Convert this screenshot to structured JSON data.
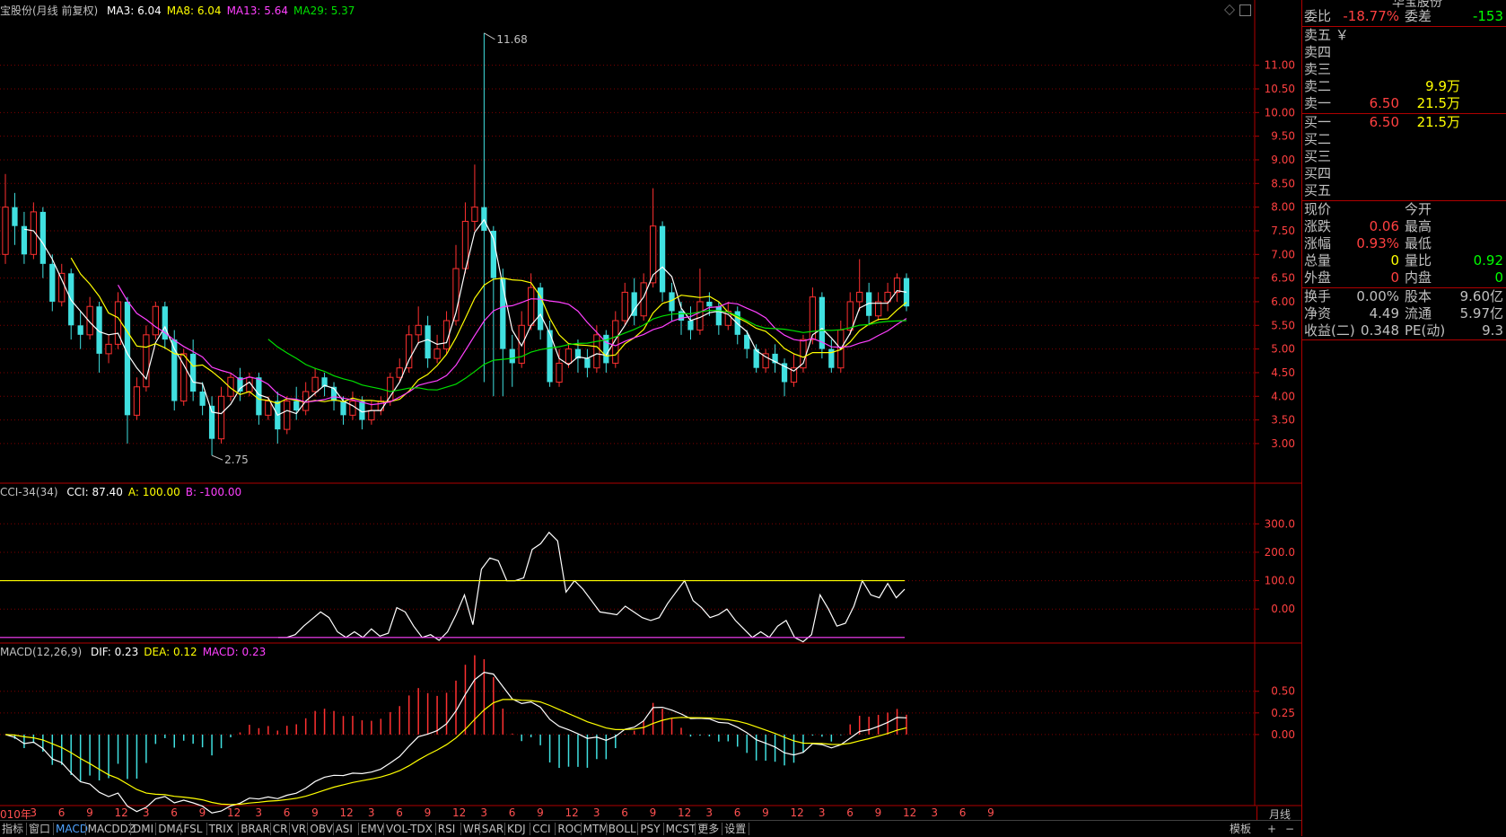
{
  "header": {
    "title": "宝股份(月线 前复权)",
    "ma": [
      {
        "label": "MA3: 6.04",
        "color": "#ffffff"
      },
      {
        "label": "MA8: 6.04",
        "color": "#ffff00"
      },
      {
        "label": "MA13: 5.64",
        "color": "#ff40ff"
      },
      {
        "label": "MA29: 5.37",
        "color": "#00e000"
      }
    ]
  },
  "cci_header": {
    "title": "CCI-34(34)",
    "items": [
      {
        "label": "CCI: 87.40",
        "color": "#ffffff"
      },
      {
        "label": "A: 100.00",
        "color": "#ffff00"
      },
      {
        "label": "B: -100.00",
        "color": "#ff40ff"
      }
    ]
  },
  "macd_header": {
    "title": "MACD(12,26,9)",
    "items": [
      {
        "label": "DIF: 0.23",
        "color": "#ffffff"
      },
      {
        "label": "DEA: 0.12",
        "color": "#ffff00"
      },
      {
        "label": "MACD: 0.23",
        "color": "#ff40ff"
      }
    ]
  },
  "annotations": {
    "high": "11.68",
    "low": "2.75"
  },
  "colors": {
    "up": "#ff3030",
    "down": "#40e0e0",
    "grid": "#800000",
    "axis_text": "#ff4040"
  },
  "chart_data": [
    {
      "type": "candlestick",
      "name": "price",
      "y_ticks": [
        "11.00",
        "10.50",
        "10.00",
        "9.50",
        "9.00",
        "8.50",
        "8.00",
        "7.50",
        "7.00",
        "6.50",
        "6.00",
        "5.50",
        "5.00",
        "4.50",
        "4.00",
        "3.50",
        "3.00"
      ],
      "ylim": [
        2.6,
        12.0
      ],
      "candles": [
        [
          7.0,
          8.0,
          6.8,
          8.7
        ],
        [
          8.0,
          7.6,
          7.2,
          8.3
        ],
        [
          7.6,
          7.0,
          6.8,
          7.9
        ],
        [
          7.0,
          7.9,
          6.9,
          8.1
        ],
        [
          7.9,
          6.8,
          6.5,
          8.0
        ],
        [
          6.8,
          6.0,
          5.8,
          7.0
        ],
        [
          6.0,
          6.6,
          5.9,
          6.8
        ],
        [
          6.6,
          5.5,
          5.2,
          6.7
        ],
        [
          5.5,
          5.3,
          5.0,
          5.8
        ],
        [
          5.3,
          5.9,
          5.2,
          6.1
        ],
        [
          5.9,
          4.9,
          4.5,
          6.0
        ],
        [
          4.9,
          5.1,
          4.7,
          5.3
        ],
        [
          5.1,
          6.0,
          5.0,
          6.2
        ],
        [
          6.0,
          3.6,
          3.0,
          6.1
        ],
        [
          3.6,
          4.2,
          3.5,
          4.4
        ],
        [
          4.2,
          5.3,
          4.1,
          5.5
        ],
        [
          5.3,
          5.9,
          5.2,
          6.0
        ],
        [
          5.9,
          5.2,
          5.0,
          6.0
        ],
        [
          5.2,
          3.9,
          3.7,
          5.4
        ],
        [
          3.9,
          4.9,
          3.8,
          5.0
        ],
        [
          4.9,
          4.1,
          3.9,
          5.2
        ],
        [
          4.1,
          3.8,
          3.6,
          4.3
        ],
        [
          3.8,
          3.1,
          2.75,
          4.0
        ],
        [
          3.1,
          4.0,
          3.0,
          4.2
        ],
        [
          4.0,
          4.4,
          3.9,
          4.5
        ],
        [
          4.4,
          4.1,
          3.9,
          4.6
        ],
        [
          4.1,
          4.4,
          4.0,
          4.5
        ],
        [
          4.4,
          3.6,
          3.4,
          4.5
        ],
        [
          3.6,
          3.9,
          3.5,
          4.0
        ],
        [
          3.9,
          3.3,
          3.0,
          4.1
        ],
        [
          3.3,
          3.9,
          3.2,
          4.0
        ],
        [
          3.9,
          3.7,
          3.5,
          4.2
        ],
        [
          3.7,
          4.1,
          3.6,
          4.3
        ],
        [
          4.1,
          4.4,
          4.0,
          4.6
        ],
        [
          4.4,
          4.2,
          4.0,
          4.5
        ],
        [
          4.2,
          3.9,
          3.7,
          4.3
        ],
        [
          3.9,
          3.6,
          3.4,
          4.0
        ],
        [
          3.6,
          3.9,
          3.5,
          4.1
        ],
        [
          3.9,
          3.5,
          3.3,
          4.0
        ],
        [
          3.5,
          3.7,
          3.4,
          3.9
        ],
        [
          3.7,
          3.9,
          3.6,
          4.0
        ],
        [
          3.9,
          4.4,
          3.8,
          4.5
        ],
        [
          4.4,
          4.6,
          4.3,
          4.8
        ],
        [
          4.6,
          5.3,
          4.5,
          5.5
        ],
        [
          5.3,
          5.5,
          5.1,
          5.9
        ],
        [
          5.5,
          4.8,
          4.6,
          5.7
        ],
        [
          4.8,
          5.0,
          4.7,
          5.3
        ],
        [
          5.0,
          5.6,
          4.9,
          5.8
        ],
        [
          5.6,
          6.7,
          5.5,
          7.2
        ],
        [
          6.7,
          7.7,
          6.6,
          8.1
        ],
        [
          7.7,
          8.0,
          7.5,
          8.9
        ],
        [
          8.0,
          7.5,
          4.3,
          11.68
        ],
        [
          7.5,
          6.5,
          4.0,
          7.6
        ],
        [
          6.5,
          5.0,
          4.0,
          6.7
        ],
        [
          5.0,
          4.7,
          4.2,
          5.3
        ],
        [
          4.7,
          5.5,
          4.6,
          5.8
        ],
        [
          5.5,
          6.3,
          5.4,
          6.6
        ],
        [
          6.3,
          5.4,
          5.2,
          6.4
        ],
        [
          5.4,
          4.3,
          4.2,
          5.6
        ],
        [
          4.3,
          4.7,
          4.2,
          5.0
        ],
        [
          4.7,
          5.0,
          4.6,
          5.1
        ],
        [
          5.0,
          4.8,
          4.5,
          5.2
        ],
        [
          4.8,
          4.6,
          4.4,
          5.0
        ],
        [
          4.6,
          5.3,
          4.5,
          5.5
        ],
        [
          5.3,
          4.7,
          4.5,
          5.4
        ],
        [
          4.7,
          5.6,
          4.6,
          5.8
        ],
        [
          5.6,
          6.2,
          5.5,
          6.4
        ],
        [
          6.2,
          5.7,
          5.5,
          6.5
        ],
        [
          5.7,
          6.4,
          5.6,
          6.6
        ],
        [
          6.4,
          7.6,
          6.3,
          8.4
        ],
        [
          7.6,
          6.2,
          6.0,
          7.7
        ],
        [
          6.2,
          5.8,
          5.6,
          6.4
        ],
        [
          5.8,
          5.6,
          5.3,
          6.0
        ],
        [
          5.6,
          5.4,
          5.2,
          5.9
        ],
        [
          5.4,
          6.0,
          5.3,
          6.7
        ],
        [
          6.0,
          5.9,
          5.7,
          6.2
        ],
        [
          5.9,
          5.5,
          5.3,
          6.0
        ],
        [
          5.5,
          5.8,
          5.4,
          6.0
        ],
        [
          5.8,
          5.3,
          5.1,
          5.9
        ],
        [
          5.3,
          5.0,
          4.8,
          5.4
        ],
        [
          5.0,
          4.6,
          4.5,
          5.1
        ],
        [
          4.6,
          4.9,
          4.5,
          5.0
        ],
        [
          4.9,
          4.7,
          4.5,
          5.1
        ],
        [
          4.7,
          4.3,
          4.0,
          4.8
        ],
        [
          4.3,
          4.6,
          4.2,
          4.9
        ],
        [
          4.6,
          5.2,
          4.5,
          5.3
        ],
        [
          5.2,
          6.1,
          5.1,
          6.3
        ],
        [
          6.1,
          5.0,
          4.8,
          6.2
        ],
        [
          5.0,
          4.6,
          4.5,
          5.2
        ],
        [
          4.6,
          5.4,
          4.5,
          5.6
        ],
        [
          5.4,
          6.0,
          5.3,
          6.2
        ],
        [
          6.0,
          6.2,
          5.8,
          6.9
        ],
        [
          6.2,
          5.7,
          5.5,
          6.4
        ],
        [
          5.7,
          6.0,
          5.6,
          6.2
        ],
        [
          6.0,
          6.2,
          5.8,
          6.4
        ],
        [
          6.2,
          6.5,
          6.0,
          6.6
        ],
        [
          6.5,
          5.9,
          5.8,
          6.6
        ]
      ],
      "x_ticks": [
        "010年",
        "3",
        "6",
        "9",
        "12",
        "3",
        "6",
        "9",
        "12",
        "3",
        "6",
        "9",
        "12",
        "3",
        "6",
        "9",
        "12",
        "3",
        "6",
        "9",
        "12",
        "3",
        "6",
        "9",
        "12",
        "3",
        "6",
        "9",
        "12",
        "3",
        "6",
        "9",
        "12",
        "3",
        "6",
        "9"
      ],
      "x_tick_period": "月线"
    },
    {
      "type": "line",
      "name": "CCI",
      "y_ticks": [
        "300.0",
        "200.0",
        "100.0",
        "0.00"
      ],
      "ylim": [
        -110,
        380
      ],
      "series": [
        {
          "name": "CCI",
          "values": [
            -100,
            -100,
            -90,
            -60,
            -35,
            -10,
            -30,
            -80,
            -100,
            -80,
            -100,
            -70,
            -95,
            -85,
            5,
            -10,
            -60,
            -100,
            -90,
            -110,
            -80,
            -20,
            50,
            -55,
            140,
            180,
            170,
            100,
            100,
            110,
            210,
            230,
            270,
            240,
            60,
            100,
            70,
            30,
            -10,
            -15,
            -20,
            10,
            -10,
            -30,
            -40,
            -30,
            20,
            60,
            100,
            30,
            5,
            -30,
            -20,
            0,
            -40,
            -70,
            -100,
            -80,
            -100,
            -60,
            -40,
            -100,
            -115,
            -90,
            50,
            0,
            -60,
            -50,
            10,
            100,
            50,
            40,
            90,
            40,
            70
          ]
        },
        {
          "name": "A",
          "values": [
            100
          ]
        },
        {
          "name": "B",
          "values": [
            -100
          ]
        }
      ]
    },
    {
      "type": "bar+line",
      "name": "MACD",
      "y_ticks": [
        "0.50",
        "0.25",
        "0.00"
      ],
      "ylim": [
        -0.8,
        0.85
      ]
    }
  ],
  "right_panel": {
    "top_title": "华宝股份",
    "ratio": {
      "label1": "委比",
      "value1": "-18.77%",
      "label2": "委差",
      "value2": "-153"
    },
    "asks": [
      {
        "label": "卖五",
        "suffix": "￥",
        "price": "",
        "vol": ""
      },
      {
        "label": "卖四",
        "suffix": "",
        "price": "",
        "vol": ""
      },
      {
        "label": "卖三",
        "suffix": "",
        "price": "",
        "vol": ""
      },
      {
        "label": "卖二",
        "suffix": "",
        "price": "",
        "vol": "9.9万"
      },
      {
        "label": "卖一",
        "suffix": "",
        "price": "6.50",
        "vol": "21.5万"
      }
    ],
    "bids": [
      {
        "label": "买一",
        "price": "6.50",
        "vol": "21.5万"
      },
      {
        "label": "买二",
        "price": "",
        "vol": ""
      },
      {
        "label": "买三",
        "price": "",
        "vol": ""
      },
      {
        "label": "买四",
        "price": "",
        "vol": ""
      },
      {
        "label": "买五",
        "price": "",
        "vol": ""
      }
    ],
    "quote": [
      {
        "l1": "现价",
        "v1": "",
        "c1": "#ff4040",
        "l2": "今开",
        "v2": "",
        "c2": "#ff4040"
      },
      {
        "l1": "涨跌",
        "v1": "0.06",
        "c1": "#ff4040",
        "l2": "最高",
        "v2": "",
        "c2": "#ff4040"
      },
      {
        "l1": "涨幅",
        "v1": "0.93%",
        "c1": "#ff4040",
        "l2": "最低",
        "v2": "",
        "c2": "#ff4040"
      },
      {
        "l1": "总量",
        "v1": "0",
        "c1": "#ffff00",
        "l2": "量比",
        "v2": "0.92",
        "c2": "#00ff00"
      },
      {
        "l1": "外盘",
        "v1": "0",
        "c1": "#ff4040",
        "l2": "内盘",
        "v2": "0",
        "c2": "#00ff00"
      }
    ],
    "stats": [
      {
        "l1": "换手",
        "v1": "0.00%",
        "l2": "股本",
        "v2": "9.60亿"
      },
      {
        "l1": "净资",
        "v1": "4.49",
        "l2": "流通",
        "v2": "5.97亿"
      },
      {
        "l1": "收益(二)",
        "v1": "0.348",
        "l2": "PE(动)",
        "v2": "9.3"
      }
    ]
  },
  "bottom_tabs": [
    "指标",
    "窗口",
    "MACD",
    "MACDDZ",
    "DMI",
    "DMA",
    "FSL",
    "TRIX",
    "BRAR",
    "CR",
    "VR",
    "OBV",
    "ASI",
    "EMV",
    "VOL-TDX",
    "RSI",
    "WR",
    "SAR",
    "KDJ",
    "CCI",
    "ROC",
    "MTM",
    "BOLL",
    "PSY",
    "MCST",
    "更多",
    "设置"
  ],
  "active_tab": "MACD",
  "bottom_right": {
    "template": "模板",
    "plus": "+",
    "minus": "−"
  }
}
